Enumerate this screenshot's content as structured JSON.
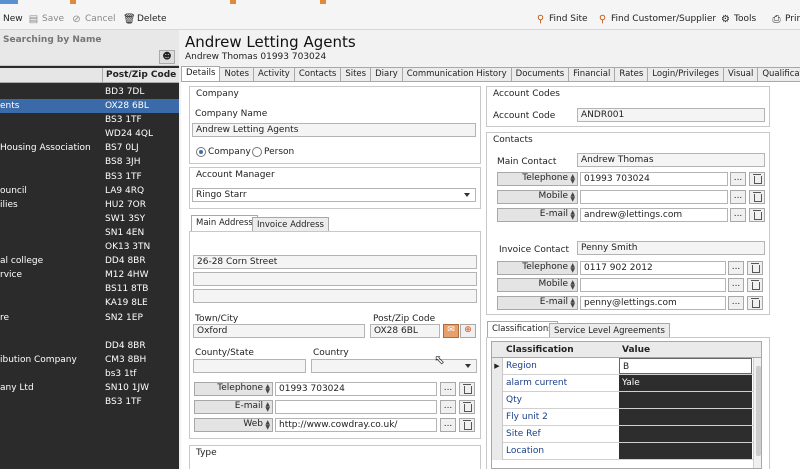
{
  "toolbar": {
    "new_label": "New",
    "save_label": "Save",
    "cancel_label": "Cancel",
    "delete_label": "Delete",
    "find_site_label": "Find Site",
    "find_customer_label": "Find Customer/Supplier",
    "tools_label": "Tools",
    "print_label": "Prin"
  },
  "search": {
    "placeholder": "Searching by Name"
  },
  "list": {
    "post_header": "Post/Zip Code",
    "rows": [
      {
        "name": "",
        "post": "BD3 7DL"
      },
      {
        "name": "ents",
        "post": "OX28 6BL",
        "selected": true
      },
      {
        "name": "",
        "post": "BS3 1TF"
      },
      {
        "name": "",
        "post": "WD24 4QL"
      },
      {
        "name": "Housing Association",
        "post": "BS7 0LJ"
      },
      {
        "name": "",
        "post": "BS8 3JH"
      },
      {
        "name": "",
        "post": "BS3 1TF"
      },
      {
        "name": "ouncil",
        "post": "LA9 4RQ"
      },
      {
        "name": "ilies",
        "post": "HU2 7OR"
      },
      {
        "name": "",
        "post": "SW1 3SY"
      },
      {
        "name": "",
        "post": "SN1 4EN"
      },
      {
        "name": "",
        "post": "OK13 3TN"
      },
      {
        "name": "al college",
        "post": "DD4 8BR"
      },
      {
        "name": "rvice",
        "post": "M12 4HW"
      },
      {
        "name": "",
        "post": "BS11 8TB"
      },
      {
        "name": "",
        "post": "KA19 8LE"
      },
      {
        "name": "re",
        "post": "SN2 1EP"
      },
      {
        "name": "",
        "post": ""
      },
      {
        "name": "",
        "post": "DD4 8BR"
      },
      {
        "name": "ibution Company",
        "post": "CM3 8BH"
      },
      {
        "name": "",
        "post": "bs3 1tf"
      },
      {
        "name": "any Ltd",
        "post": "SN10 1JW"
      },
      {
        "name": "",
        "post": "BS3 1TF"
      }
    ]
  },
  "header": {
    "title": "Andrew Letting Agents",
    "subtitle": "Andrew Thomas 01993 703024"
  },
  "tabs": [
    {
      "label": "Details",
      "active": true
    },
    {
      "label": "Notes"
    },
    {
      "label": "Activity"
    },
    {
      "label": "Contacts"
    },
    {
      "label": "Sites"
    },
    {
      "label": "Diary"
    },
    {
      "label": "Communication History"
    },
    {
      "label": "Documents"
    },
    {
      "label": "Financial"
    },
    {
      "label": "Rates"
    },
    {
      "label": "Login/Privileges"
    },
    {
      "label": "Visual"
    },
    {
      "label": "Qualifications"
    }
  ],
  "company": {
    "group_title": "Company",
    "name_label": "Company Name",
    "name_value": "Andrew Letting Agents",
    "radio_company": "Company",
    "radio_person": "Person"
  },
  "account_manager": {
    "group_title": "Account Manager",
    "value": "Ringo Starr"
  },
  "address": {
    "tab_main": "Main Address",
    "tab_invoice": "Invoice Address",
    "line1": "26-28 Corn Street",
    "line2": "",
    "line3": "",
    "town_label": "Town/City",
    "town_value": "Oxford",
    "post_label": "Post/Zip Code",
    "post_value": "OX28 6BL",
    "county_label": "County/State",
    "county_value": "",
    "country_label": "Country",
    "country_value": "",
    "telephone_label": "Telephone",
    "telephone_value": "01993 703024",
    "email_label": "E-mail",
    "email_value": "",
    "web_label": "Web",
    "web_value": "http://www.cowdray.co.uk/"
  },
  "type_group": {
    "title": "Type"
  },
  "account_codes": {
    "group_title": "Account Codes",
    "code_label": "Account Code",
    "code_value": "ANDR001"
  },
  "contacts": {
    "group_title": "Contacts",
    "main_label": "Main Contact",
    "main_value": "Andrew Thomas",
    "main_tel_label": "Telephone",
    "main_tel_value": "01993 703024",
    "main_mobile_label": "Mobile",
    "main_mobile_value": "",
    "main_email_label": "E-mail",
    "main_email_value": "andrew@lettings.com",
    "invoice_label": "Invoice Contact",
    "invoice_value": "Penny Smith",
    "inv_tel_label": "Telephone",
    "inv_tel_value": "0117 902 2012",
    "inv_mobile_label": "Mobile",
    "inv_mobile_value": "",
    "inv_email_label": "E-mail",
    "inv_email_value": "penny@lettings.com"
  },
  "classifications": {
    "tab_classifications": "Classifications",
    "tab_sla": "Service Level Agreements",
    "col_classification": "Classification",
    "col_value": "Value",
    "rows": [
      {
        "key": "Region",
        "value": "B"
      },
      {
        "key": "alarm current",
        "value": "Yale"
      },
      {
        "key": "Qty",
        "value": ""
      },
      {
        "key": "Fly unit 2",
        "value": ""
      },
      {
        "key": "Site Ref",
        "value": ""
      },
      {
        "key": "Location",
        "value": ""
      }
    ]
  },
  "colors": {
    "accent": "#3b6aa8",
    "list_bg": "#2b2b2b",
    "grid_value_bg": "#2d2d2d"
  }
}
